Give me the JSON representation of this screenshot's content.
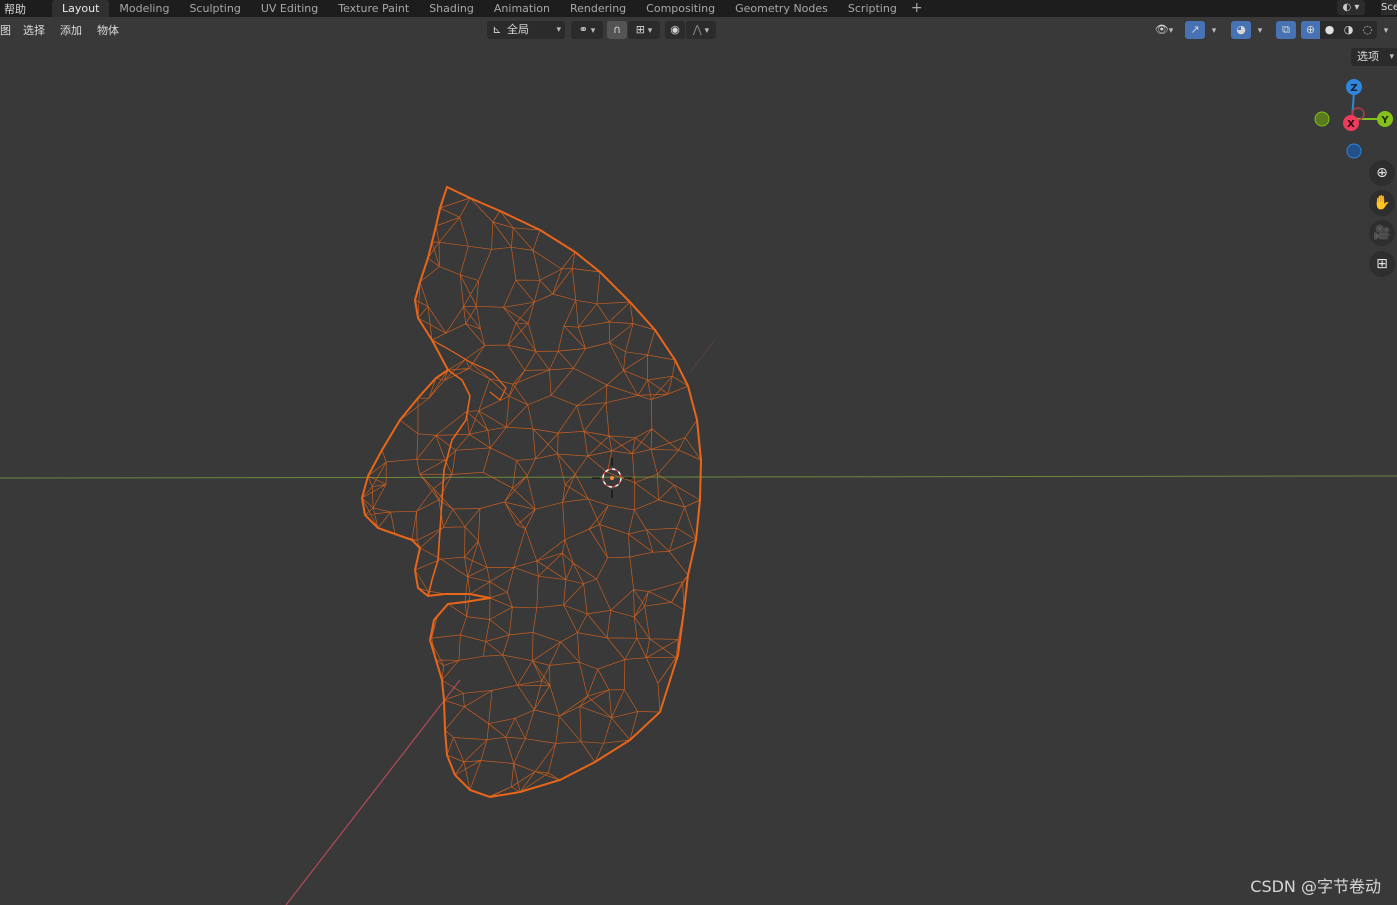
{
  "topbar": {
    "help_menu": "帮助",
    "workspace_tabs": [
      {
        "label": "Layout",
        "active": true
      },
      {
        "label": "Modeling",
        "active": false
      },
      {
        "label": "Sculpting",
        "active": false
      },
      {
        "label": "UV Editing",
        "active": false
      },
      {
        "label": "Texture Paint",
        "active": false
      },
      {
        "label": "Shading",
        "active": false
      },
      {
        "label": "Animation",
        "active": false
      },
      {
        "label": "Rendering",
        "active": false
      },
      {
        "label": "Compositing",
        "active": false
      },
      {
        "label": "Geometry Nodes",
        "active": false
      },
      {
        "label": "Scripting",
        "active": false
      }
    ],
    "add_tab": "+",
    "scene_name": "Sce"
  },
  "header": {
    "menus": [
      "图",
      "选择",
      "添加",
      "物体"
    ],
    "transform_orientation": "全局",
    "options_label": "选项"
  },
  "gizmo": {
    "z": "Z",
    "y": "Y",
    "x": "X"
  },
  "colors": {
    "wire": "#e8661a",
    "x_axis": "#ee3b5b",
    "y_axis": "#84c21b",
    "z_axis": "#2f86dc",
    "background": "#393939"
  },
  "watermark": "CSDN @字节卷动"
}
